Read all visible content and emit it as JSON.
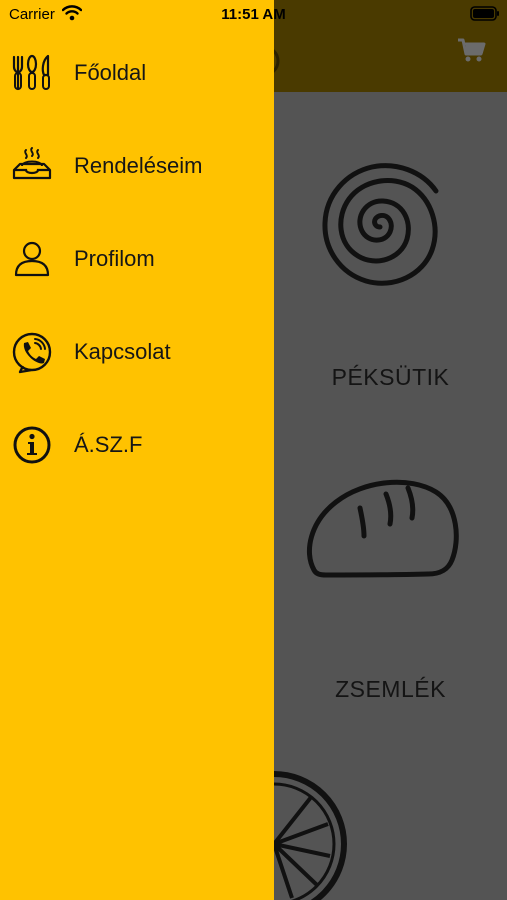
{
  "status_bar": {
    "carrier": "Carrier",
    "time": "11:51 AM"
  },
  "drawer": {
    "background_color": "#ffc200",
    "items": [
      {
        "label": "Főoldal",
        "icon": "fork-knife-icon"
      },
      {
        "label": "Rendeléseim",
        "icon": "food-tray-icon"
      },
      {
        "label": "Profilom",
        "icon": "user-icon"
      },
      {
        "label": "Kapcsolat",
        "icon": "phone-icon"
      },
      {
        "label": "Á.SZ.F",
        "icon": "info-icon"
      }
    ]
  },
  "main": {
    "categories": [
      {
        "label": "PÉKSÜTIK",
        "icon": "pastry-swirl-icon"
      },
      {
        "label": "ZSEMLÉK",
        "icon": "bread-roll-icon"
      },
      {
        "icon": "citrus-slice-icon"
      }
    ],
    "cart_icon": "cart-icon"
  }
}
